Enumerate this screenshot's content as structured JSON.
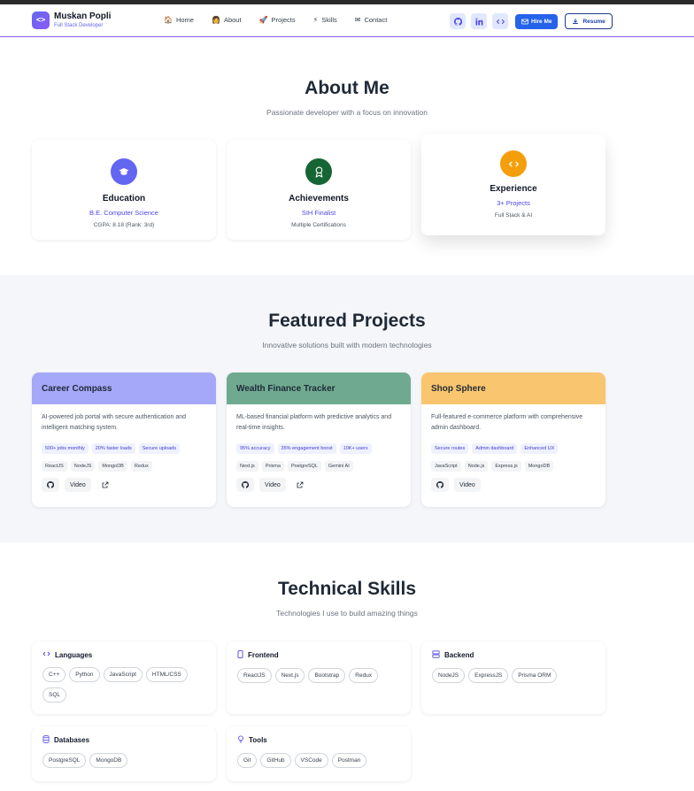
{
  "nav": {
    "logo_glyph": "<>",
    "name": "Muskan Popli",
    "subtitle": "Full Stack Developer",
    "menu": [
      {
        "label": "Home",
        "icon": "house-icon",
        "glyph": "🏠"
      },
      {
        "label": "About",
        "icon": "person-icon",
        "glyph": "👩"
      },
      {
        "label": "Projects",
        "icon": "rocket-icon",
        "glyph": "🚀"
      },
      {
        "label": "Skills",
        "icon": "lightning-icon",
        "glyph": "⚡"
      },
      {
        "label": "Contact",
        "icon": "envelope-icon",
        "glyph": "✉"
      }
    ],
    "hire_label": "Hire Me",
    "resume_label": "Resume"
  },
  "about": {
    "title": "About Me",
    "subtitle": "Passionate developer with a focus on innovation",
    "cards": [
      {
        "title": "Education",
        "line1": "B.E. Computer Science",
        "line2": "CGPA: 8.18 (Rank: 3rd)",
        "color": "#6366f1",
        "icon": "graduation-cap-icon"
      },
      {
        "title": "Achievements",
        "line1": "SIH Finalist",
        "line2": "Multiple Certifications",
        "color": "#166534",
        "icon": "award-icon"
      },
      {
        "title": "Experience",
        "line1": "3+ Projects",
        "line2": "Full Stack & AI",
        "color": "#f59e0b",
        "icon": "code-icon"
      }
    ]
  },
  "projects": {
    "title": "Featured Projects",
    "subtitle": "Innovative solutions built with modern technologies",
    "cards": [
      {
        "title": "Career Compass",
        "color": "#a5a8f8",
        "desc": "AI-powered job portal with secure authentication and intelligent matching system.",
        "metrics": [
          "500+ jobs monthly",
          "20% faster loads",
          "Secure uploads"
        ],
        "tech": [
          "ReactJS",
          "NodeJS",
          "MongoDB",
          "Redux"
        ],
        "actions": [
          "Video"
        ],
        "external": true
      },
      {
        "title": "Wealth Finance Tracker",
        "color": "#6faa90",
        "desc": "ML-based financial platform with predictive analytics and real-time insights.",
        "metrics": [
          "95% accuracy",
          "35% engagement boost",
          "10K+ users"
        ],
        "tech": [
          "Next.js",
          "Prisma",
          "PostgreSQL",
          "Gemini AI"
        ],
        "actions": [
          "Video"
        ],
        "external": true
      },
      {
        "title": "Shop Sphere",
        "color": "#f9c56e",
        "desc": "Full-featured e-commerce platform with comprehensive admin dashboard.",
        "metrics": [
          "Secure routes",
          "Admin dashboard",
          "Enhanced UX"
        ],
        "tech": [
          "JavaScript",
          "Node.js",
          "Express.js",
          "MongoDB"
        ],
        "actions": [
          "Video"
        ],
        "external": false
      }
    ]
  },
  "skills": {
    "title": "Technical Skills",
    "subtitle": "Technologies I use to build amazing things",
    "groups": [
      {
        "title": "Languages",
        "icon": "code-icon",
        "glyph": "‹›",
        "items": [
          "C++",
          "Python",
          "JavaScript",
          "HTML/CSS",
          "SQL"
        ]
      },
      {
        "title": "Frontend",
        "icon": "mobile-icon",
        "glyph": "▯",
        "items": [
          "ReactJS",
          "Next.js",
          "Bootstrap",
          "Redux"
        ]
      },
      {
        "title": "Backend",
        "icon": "server-icon",
        "glyph": "☰",
        "items": [
          "NodeJS",
          "ExpressJS",
          "Prisma ORM"
        ]
      },
      {
        "title": "Databases",
        "icon": "database-icon",
        "glyph": "⛁",
        "items": [
          "PostgreSQL",
          "MongoDB"
        ]
      },
      {
        "title": "Tools",
        "icon": "lightbulb-icon",
        "glyph": "♁",
        "items": [
          "Git",
          "GitHub",
          "VSCode",
          "Postman"
        ]
      }
    ]
  }
}
